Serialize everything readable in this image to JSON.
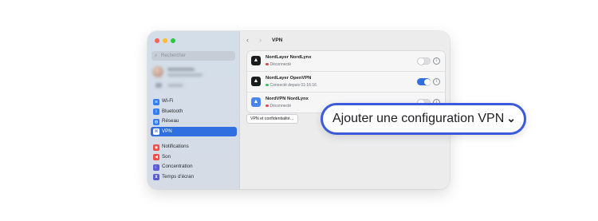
{
  "window": {
    "search": {
      "placeholder": "Rechercher",
      "icon": "search-icon"
    },
    "sidebar": {
      "group1": [
        {
          "label": "Wi-Fi",
          "icon": "wifi-icon",
          "color": "#2f7ef6",
          "glyph": "≋"
        },
        {
          "label": "Bluetooth",
          "icon": "bluetooth-icon",
          "color": "#2f7ef6",
          "glyph": "ᛒ"
        },
        {
          "label": "Réseau",
          "icon": "globe-icon",
          "color": "#2f7ef6",
          "glyph": "◍"
        },
        {
          "label": "VPN",
          "icon": "vpn-icon",
          "color": "#2f7ef6",
          "glyph": "⌘",
          "active": true
        }
      ],
      "group2": [
        {
          "label": "Notifications",
          "icon": "bell-icon",
          "color": "#ee4b44",
          "glyph": "◉"
        },
        {
          "label": "Son",
          "icon": "speaker-icon",
          "color": "#ee4b44",
          "glyph": "◀"
        },
        {
          "label": "Concentration",
          "icon": "moon-icon",
          "color": "#5b5bd6",
          "glyph": "☾"
        },
        {
          "label": "Temps d'écran",
          "icon": "hourglass-icon",
          "color": "#5b5bd6",
          "glyph": "⧗"
        }
      ]
    },
    "header": {
      "title": "VPN",
      "back_glyph": "‹",
      "forward_glyph": "›"
    },
    "vpns": [
      {
        "name": "NordLayer NordLynx",
        "status": "Déconnecté",
        "status_color": "#e5483f",
        "enabled": false,
        "icon": "nordlayer-icon",
        "icon_color": "#1b1c1e"
      },
      {
        "name": "NordLayer OpenVPN",
        "status": "Connecté depuis 01:16:16",
        "status_color": "#34c759",
        "enabled": true,
        "icon": "nordlayer-icon",
        "icon_color": "#1b1c1e"
      },
      {
        "name": "NordVPN NordLynx",
        "status": "Déconnecté",
        "status_color": "#e5483f",
        "enabled": false,
        "icon": "nordvpn-icon",
        "icon_color": "#4a86e8"
      }
    ],
    "privacy_button": "VPN et confidentialité…"
  },
  "callout": {
    "label": "Ajouter une configuration VPN",
    "accent": "#3b5bdb"
  }
}
